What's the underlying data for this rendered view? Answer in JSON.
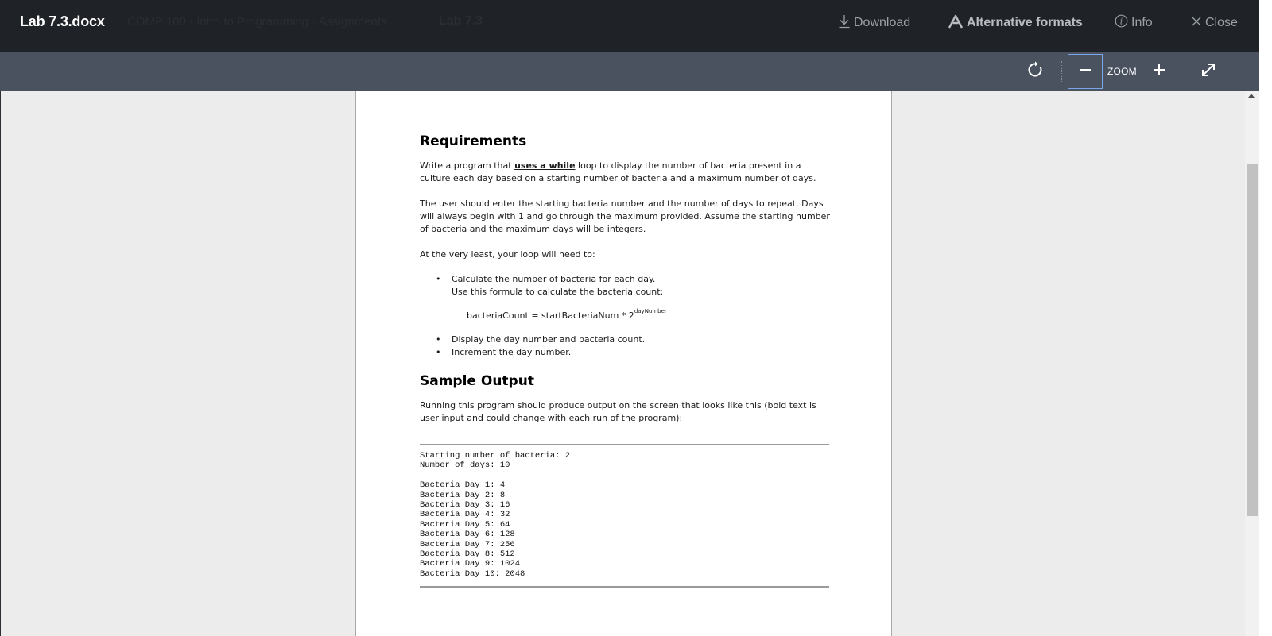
{
  "header": {
    "document_title": "Lab 7.3.docx",
    "background_breadcrumb": "COMP 100 - Intro to Programming · Assignments",
    "background_tab": "Lab 7.3",
    "actions": {
      "download": "Download",
      "alternative_formats": "Alternative formats",
      "info": "Info",
      "close": "Close"
    }
  },
  "toolbar": {
    "zoom_label": "ZOOM"
  },
  "colors": {
    "header_bg": "#1f2226",
    "toolbar_bg": "#4a5260",
    "viewer_bg": "#ececec",
    "focus_outline": "#7aa7e8"
  },
  "document": {
    "requirements_heading": "Requirements",
    "intro_prefix": "Write a program that ",
    "intro_emphasis": "uses a while",
    "intro_suffix": " loop to display the number of bacteria present in a culture each day based on a starting number of bacteria and a maximum number of days.",
    "para_user_input": "The user should enter the starting bacteria number and the number of days to repeat. Days will always begin with 1 and go through the maximum provided. Assume the starting number of bacteria and the maximum days will be integers.",
    "para_loop_intro": "At the very least, your loop will need to:",
    "bullet_calculate": "Calculate the number of bacteria for each day.",
    "bullet_calculate_sub": "Use this formula to calculate the bacteria count:",
    "formula_base": "bacteriaCount = startBacteriaNum * 2",
    "formula_exponent": "dayNumber",
    "bullet_display": "Display the day number and bacteria count.",
    "bullet_increment": "Increment the day number.",
    "sample_heading": "Sample Output",
    "sample_intro": "Running this program should produce output on the screen that looks like this (bold text is user input and could change with each run of the program):",
    "sample_output": "Starting number of bacteria: 2\nNumber of days: 10\n\nBacteria Day 1: 4\nBacteria Day 2: 8\nBacteria Day 3: 16\nBacteria Day 4: 32\nBacteria Day 5: 64\nBacteria Day 6: 128\nBacteria Day 7: 256\nBacteria Day 8: 512\nBacteria Day 9: 1024\nBacteria Day 10: 2048"
  }
}
